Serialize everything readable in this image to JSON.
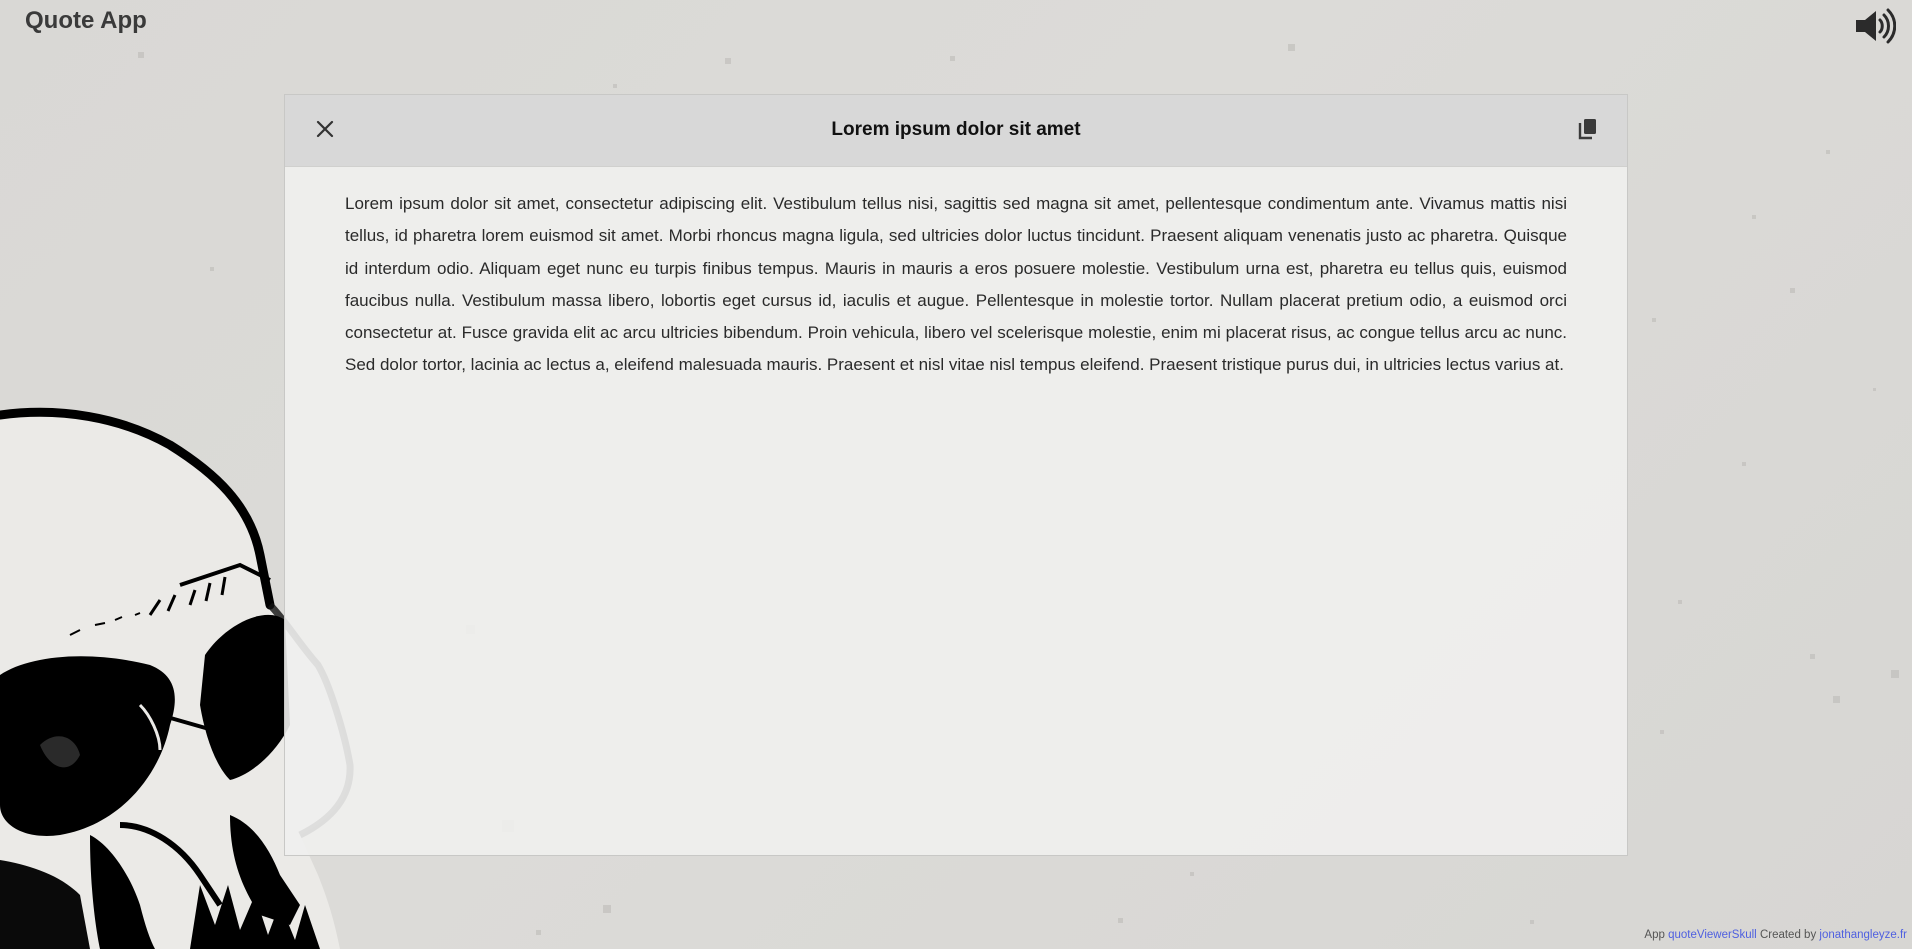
{
  "app": {
    "title": "Quote App"
  },
  "header": {
    "sound_icon": "volume-up-icon"
  },
  "modal": {
    "title": "Lorem ipsum dolor sit amet",
    "close_icon": "close-icon",
    "copy_icon": "copy-icon",
    "text": "Lorem ipsum dolor sit amet, consectetur adipiscing elit. Vestibulum tellus nisi, sagittis sed magna sit amet, pellentesque condimentum ante. Vivamus mattis nisi tellus, id pharetra lorem euismod sit amet. Morbi rhoncus magna ligula, sed ultricies dolor luctus tincidunt. Praesent aliquam venenatis justo ac pharetra. Quisque id interdum odio. Aliquam eget nunc eu turpis finibus tempus. Mauris in mauris a eros posuere molestie. Vestibulum urna est, pharetra eu tellus quis, euismod faucibus nulla. Vestibulum massa libero, lobortis eget cursus id, iaculis et augue. Pellentesque in molestie tortor. Nullam placerat pretium odio, a euismod orci consectetur at. Fusce gravida elit ac arcu ultricies bibendum. Proin vehicula, libero vel scelerisque molestie, enim mi placerat risus, ac congue tellus arcu ac nunc. Sed dolor tortor, lacinia ac lectus a, eleifend malesuada mauris. Praesent et nisl vitae nisl tempus eleifend. Praesent tristique purus dui, in ultricies lectus varius at."
  },
  "footer": {
    "prefix": "App",
    "app_link": "quoteViewerSkull",
    "middle": "Created by",
    "author_link": "jonathangleyze.fr"
  },
  "colors": {
    "background": "#dad9d6",
    "modal_header": "#d6d6d6",
    "modal_body": "#efefed",
    "link": "#4f60e0"
  }
}
